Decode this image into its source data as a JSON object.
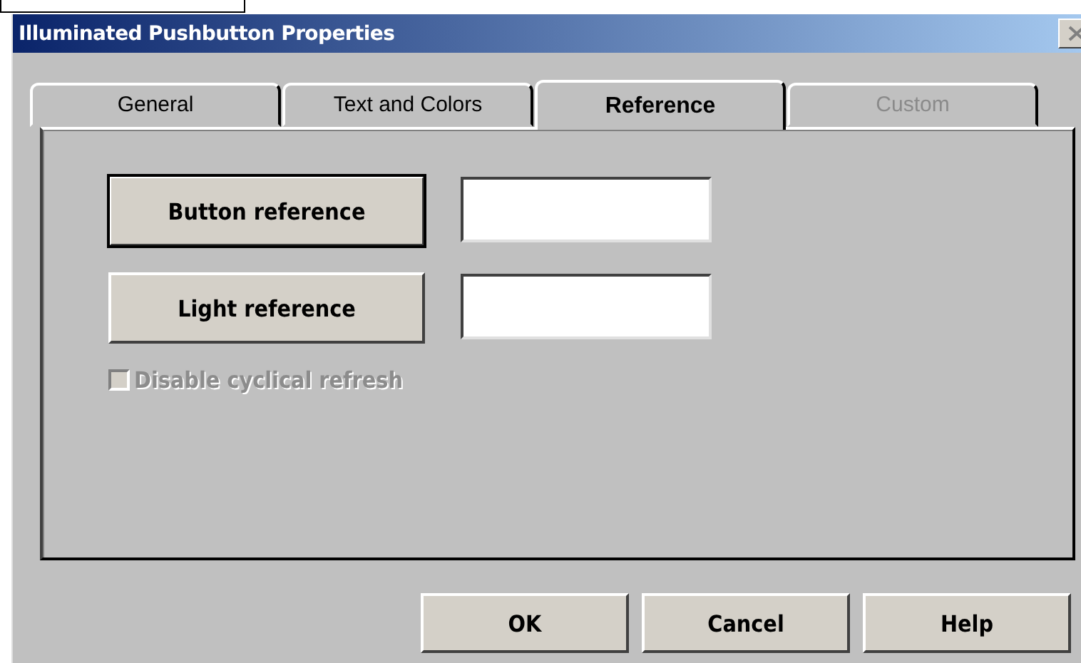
{
  "window": {
    "title": "Illuminated Pushbutton Properties"
  },
  "tabs": [
    {
      "label": "General",
      "selected": false,
      "disabled": false
    },
    {
      "label": "Text and Colors",
      "selected": false,
      "disabled": false
    },
    {
      "label": "Reference",
      "selected": true,
      "disabled": false
    },
    {
      "label": "Custom",
      "selected": false,
      "disabled": true
    }
  ],
  "references": [
    {
      "button": "Button reference",
      "default": true
    },
    {
      "button": "Light reference",
      "default": false
    }
  ],
  "checkbox": {
    "label": "Disable cyclical refresh",
    "checked": false,
    "disabled": true
  },
  "buttons": [
    "OK",
    "Cancel",
    "Help"
  ]
}
